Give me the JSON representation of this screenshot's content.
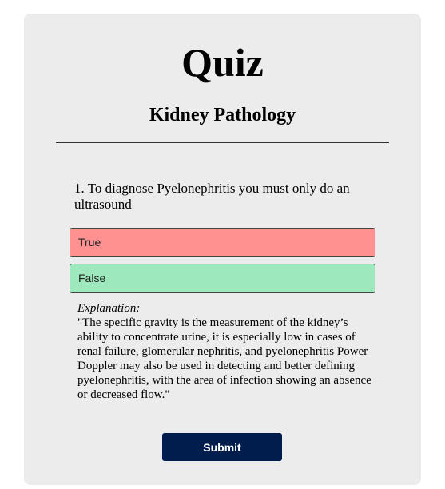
{
  "quiz": {
    "title": "Quiz",
    "subtitle": "Kidney Pathology"
  },
  "question": {
    "number_text": "1. To diagnose Pyelonephritis you must only do an ultrasound",
    "options": [
      {
        "label": "True",
        "state": "incorrect",
        "color": "#ff9191"
      },
      {
        "label": "False",
        "state": "correct",
        "color": "#9de9bd"
      }
    ]
  },
  "explanation": {
    "label": "Explanation:",
    "text": "\"The specific gravity is the measurement of the kidney’s ability to concentrate urine, it is especially low in cases of renal failure, glomerular nephritis, and pyelonephritis Power Doppler may also be used in detecting and better defining pyelonephritis, with the area of infection showing an absence or decreased flow.\""
  },
  "actions": {
    "submit_label": "Submit",
    "submit_color": "#011d4d"
  }
}
